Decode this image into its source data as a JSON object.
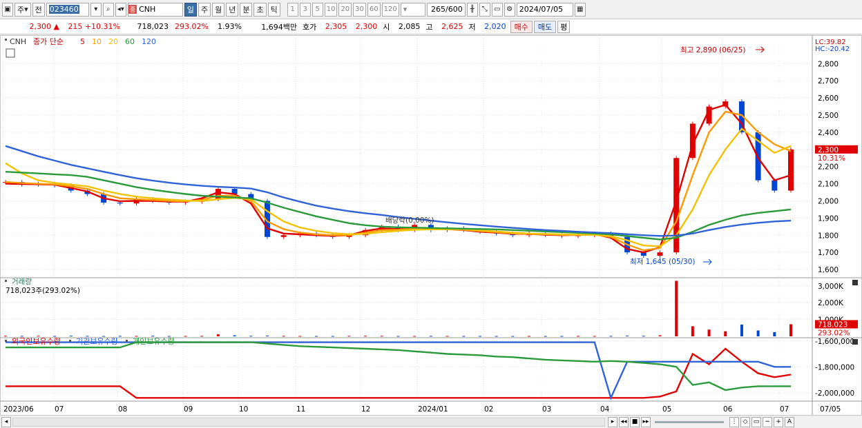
{
  "toolbar": {
    "type_select": "주",
    "prev_label": "전",
    "code": "023460",
    "name": "CNH",
    "name_badge": "종",
    "periods": [
      "일",
      "주",
      "월",
      "년",
      "분",
      "초",
      "틱"
    ],
    "active_period": "일",
    "minute_steps": [
      "1",
      "3",
      "5",
      "10",
      "20",
      "30",
      "60",
      "120"
    ],
    "count": "265",
    "count_total": "/600",
    "date": "2024/07/05"
  },
  "quote": {
    "price": "2,300",
    "change": "215 +10.31%",
    "volume": "718,023",
    "volume_ratio": "293.02%",
    "turnover": "1.93%",
    "amount": "1,694백만",
    "bid_label": "호가",
    "bid1": "2,305",
    "bid2": "2,300",
    "open_label": "시",
    "open": "2,085",
    "high_label": "고",
    "high": "2,625",
    "low_label": "저",
    "low": "2,020",
    "buy_label": "매수",
    "sell_label": "매도",
    "eval_label": "평"
  },
  "legend": {
    "name": "CNH",
    "type": "종가 단순",
    "ma": [
      {
        "label": "5",
        "color": "#e00000"
      },
      {
        "label": "10",
        "color": "#ff9900"
      },
      {
        "label": "20",
        "color": "#f2c200"
      },
      {
        "label": "60",
        "color": "#2a9a3a"
      },
      {
        "label": "120",
        "color": "#2d62d8"
      }
    ]
  },
  "lc": "LC:39.82",
  "hc": "HC:-20.42",
  "price_tag": "2,300",
  "change_tag": "10.31%",
  "annotations": {
    "high": "최고 2,890 (06/25)",
    "low": "최저 1,645 (05/30)",
    "dividend": "배당락(0.00%)"
  },
  "volume_panel": {
    "title": "거래량",
    "value": "718,023주(293.02%)",
    "tag": "718,023",
    "tag2": "293.02%",
    "ticks": [
      "3,000K",
      "2,000K",
      "1,000K"
    ]
  },
  "holding_panel": {
    "series": [
      {
        "name": "외국인보유수량",
        "color": "#e00000"
      },
      {
        "name": "기관보유수량",
        "color": "#2d62d8"
      },
      {
        "name": "개인보유수량",
        "color": "#2a9a3a"
      }
    ],
    "ticks": [
      "-1,600,000",
      "-1,800,000",
      "-2,000,000"
    ]
  },
  "colors": {
    "up": "#e00000",
    "down": "#0046d5",
    "grid": "#e0e0e0"
  },
  "chart_data": {
    "type": "candlestick",
    "title": "CNH",
    "ylim": [
      1560,
      2950
    ],
    "yticks": [
      1600,
      1700,
      1800,
      1900,
      2000,
      2100,
      2200,
      2300,
      2400,
      2500,
      2600,
      2700,
      2800
    ],
    "x_labels": [
      "2023/06",
      "07",
      "08",
      "09",
      "10",
      "11",
      "12",
      "2024/01",
      "02",
      "03",
      "04",
      "05",
      "06",
      "07",
      "07/05"
    ],
    "close": [
      2110,
      2095,
      2100,
      2090,
      2060,
      2040,
      1990,
      1985,
      2010,
      2000,
      1990,
      1995,
      2010,
      2070,
      2040,
      2000,
      1790,
      1800,
      1810,
      1800,
      1790,
      1800,
      1830,
      1850,
      1830,
      1860,
      1830,
      1840,
      1830,
      1820,
      1810,
      1800,
      1810,
      1800,
      1795,
      1800,
      1810,
      1790,
      1700,
      1680,
      1700,
      2250,
      2450,
      2550,
      2580,
      2400,
      2120,
      2060,
      2300
    ],
    "ma": {
      "5": [
        2100,
        2098,
        2097,
        2094,
        2075,
        2055,
        2015,
        1998,
        2000,
        2000,
        1996,
        1995,
        2015,
        2050,
        2040,
        1985,
        1840,
        1810,
        1805,
        1800,
        1796,
        1800,
        1825,
        1840,
        1835,
        1845,
        1835,
        1835,
        1830,
        1820,
        1815,
        1808,
        1808,
        1803,
        1800,
        1802,
        1806,
        1785,
        1720,
        1700,
        1730,
        2000,
        2330,
        2530,
        2560,
        2450,
        2250,
        2120,
        2150
      ],
      "10": [
        2110,
        2104,
        2100,
        2096,
        2085,
        2070,
        2040,
        2015,
        2010,
        2005,
        2000,
        1997,
        2005,
        2030,
        2030,
        2000,
        1880,
        1835,
        1815,
        1805,
        1800,
        1800,
        1815,
        1830,
        1832,
        1840,
        1838,
        1836,
        1832,
        1824,
        1818,
        1810,
        1808,
        1806,
        1802,
        1802,
        1803,
        1790,
        1745,
        1712,
        1725,
        1880,
        2150,
        2400,
        2520,
        2500,
        2400,
        2330,
        2290
      ],
      "20": [
        2220,
        2160,
        2120,
        2105,
        2095,
        2085,
        2060,
        2040,
        2025,
        2015,
        2008,
        2002,
        2000,
        2010,
        2018,
        2010,
        1940,
        1880,
        1845,
        1825,
        1812,
        1806,
        1808,
        1818,
        1825,
        1832,
        1834,
        1834,
        1833,
        1828,
        1822,
        1815,
        1810,
        1807,
        1805,
        1803,
        1802,
        1795,
        1770,
        1740,
        1735,
        1800,
        1950,
        2150,
        2300,
        2420,
        2350,
        2280,
        2320
      ],
      "60": [
        2170,
        2165,
        2160,
        2155,
        2150,
        2140,
        2120,
        2100,
        2080,
        2065,
        2052,
        2040,
        2030,
        2025,
        2020,
        2015,
        1990,
        1960,
        1935,
        1910,
        1890,
        1870,
        1858,
        1850,
        1846,
        1844,
        1842,
        1840,
        1838,
        1836,
        1834,
        1830,
        1826,
        1822,
        1818,
        1814,
        1810,
        1805,
        1795,
        1785,
        1775,
        1785,
        1820,
        1860,
        1890,
        1915,
        1930,
        1940,
        1950
      ],
      "120": [
        2320,
        2290,
        2260,
        2235,
        2210,
        2190,
        2170,
        2150,
        2132,
        2118,
        2106,
        2096,
        2088,
        2082,
        2078,
        2072,
        2050,
        2020,
        1995,
        1972,
        1955,
        1940,
        1928,
        1918,
        1906,
        1895,
        1885,
        1875,
        1866,
        1858,
        1850,
        1843,
        1836,
        1830,
        1825,
        1820,
        1816,
        1812,
        1806,
        1800,
        1796,
        1798,
        1810,
        1830,
        1848,
        1862,
        1872,
        1880,
        1885
      ]
    },
    "volume_k": [
      30,
      25,
      30,
      20,
      35,
      25,
      20,
      25,
      20,
      30,
      20,
      20,
      25,
      120,
      60,
      30,
      40,
      25,
      20,
      20,
      20,
      25,
      30,
      25,
      20,
      20,
      25,
      20,
      20,
      20,
      20,
      20,
      20,
      20,
      20,
      20,
      20,
      25,
      40,
      30,
      60,
      3300,
      600,
      400,
      300,
      700,
      350,
      250,
      718
    ],
    "holdings": {
      "외국인보유수량": [
        -1950000,
        -1950000,
        -1950000,
        -1950000,
        -1950000,
        -1950000,
        -1950000,
        -1950000,
        -2040000,
        -2040000,
        -2040000,
        -2040000,
        -2040000,
        -2040000,
        -2040000,
        -2040000,
        -2040000,
        -2040000,
        -2040000,
        -2040000,
        -2040000,
        -2040000,
        -2040000,
        -2040000,
        -2040000,
        -2040000,
        -2040000,
        -2040000,
        -2040000,
        -2040000,
        -2040000,
        -2040000,
        -2040000,
        -2040000,
        -2040000,
        -2040000,
        -2040000,
        -2040000,
        -2040000,
        -2040000,
        -2030000,
        -1990000,
        -1700000,
        -1780000,
        -1660000,
        -1760000,
        -1850000,
        -1880000,
        -1860000
      ],
      "기관보유수량": [
        -1610000,
        -1610000,
        -1610000,
        -1610000,
        -1610000,
        -1610000,
        -1610000,
        -1610000,
        -1610000,
        -1610000,
        -1610000,
        -1610000,
        -1610000,
        -1610000,
        -1610000,
        -1610000,
        -1610000,
        -1610000,
        -1610000,
        -1610000,
        -1610000,
        -1610000,
        -1610000,
        -1610000,
        -1610000,
        -1610000,
        -1610000,
        -1610000,
        -1610000,
        -1610000,
        -1610000,
        -1610000,
        -1610000,
        -1610000,
        -1610000,
        -1610000,
        -1610000,
        -2040000,
        -1760000,
        -1760000,
        -1760000,
        -1760000,
        -1760000,
        -1760000,
        -1760000,
        -1760000,
        -1760000,
        -1800000,
        -1800000
      ],
      "개인보유수량": [
        -1650000,
        -1650000,
        -1650000,
        -1650000,
        -1650000,
        -1650000,
        -1650000,
        -1650000,
        -1610000,
        -1610000,
        -1610000,
        -1610000,
        -1610000,
        -1610000,
        -1610000,
        -1610000,
        -1620000,
        -1630000,
        -1640000,
        -1645000,
        -1650000,
        -1655000,
        -1660000,
        -1665000,
        -1670000,
        -1680000,
        -1690000,
        -1700000,
        -1705000,
        -1710000,
        -1720000,
        -1725000,
        -1735000,
        -1745000,
        -1750000,
        -1755000,
        -1760000,
        -1755000,
        -1760000,
        -1770000,
        -1780000,
        -1800000,
        -1940000,
        -1920000,
        -1980000,
        -1960000,
        -1950000,
        -1950000,
        -1950000
      ]
    }
  }
}
